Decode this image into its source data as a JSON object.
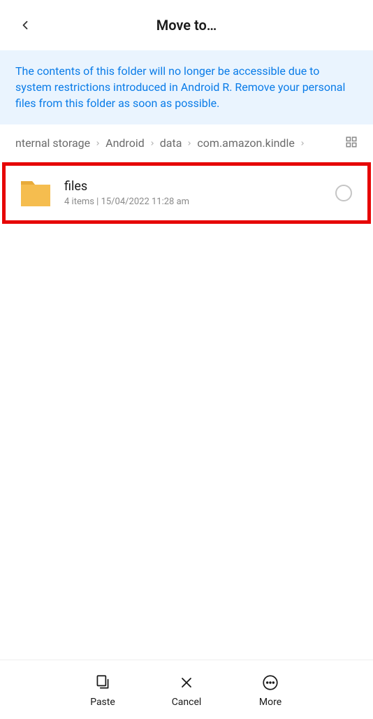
{
  "header": {
    "title": "Move to…"
  },
  "warning": {
    "text": "The contents of this folder will no longer be accessible due to system restrictions introduced in Android R. Remove your personal files from this folder as soon as possible."
  },
  "breadcrumb": {
    "items": [
      {
        "label": "nternal storage"
      },
      {
        "label": "Android"
      },
      {
        "label": "data"
      },
      {
        "label": "com.amazon.kindle"
      }
    ]
  },
  "folder": {
    "name": "files",
    "meta": "4 items  |  15/04/2022 11:28 am"
  },
  "bottomBar": {
    "paste": "Paste",
    "cancel": "Cancel",
    "more": "More"
  }
}
